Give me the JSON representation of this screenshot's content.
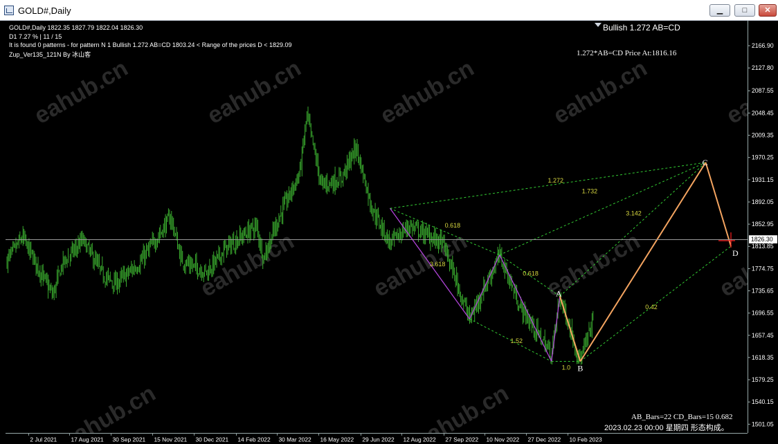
{
  "window": {
    "title": "GOLD#,Daily",
    "buttons": {
      "minimize": "▁",
      "maximize": "□",
      "close": "✕"
    }
  },
  "header": {
    "symbol_line": "GOLD#,Daily  1822.35 1827.79 1822.04 1826.30",
    "timeframe_line": "D1  7.27 %  |  11 / 15",
    "found_line": "It is found 0 patterns  -  for pattern N 1 Bullish 1.272 AB=CD  1803.24 < Range of the prices D < 1829.09",
    "indicator_line": "Zup_Ver135_121N By 冰山客"
  },
  "pattern": {
    "title": "Bullish 1.272 AB=CD",
    "target_label": "1.272*AB=CD Price At:1816.16",
    "bars_info": "AB_Bars=22 CD_Bars=15 0.682",
    "datetime": "2023.02.23 00:00  星期四  形态构成。",
    "points": [
      {
        "label": "A",
        "date": "2022-10-04",
        "price": 1729
      },
      {
        "label": "B",
        "date": "2022-10-21",
        "price": 1617
      },
      {
        "label": "C",
        "date": "2023-02-02",
        "price": 1959
      },
      {
        "label": "D",
        "date": "2023-02-23",
        "price": 1815
      }
    ],
    "ratios": [
      "1.272",
      "1.732",
      "0.618",
      "3.142",
      "3.618",
      "0.618",
      "1.52",
      "1.0",
      "0.42"
    ]
  },
  "watermark": "eahub.cn",
  "colors": {
    "background": "#000000",
    "bullish_candle": "#3aaa2e",
    "cd_leg": "#f4a460",
    "xa_leg": "#b044d8",
    "ratio_lines": "#33cc33",
    "ratio_text": "#d8d840",
    "price_line": "#9a9a9a"
  },
  "chart_data": {
    "type": "candlestick",
    "symbol": "GOLD#",
    "timeframe": "Daily",
    "current_price": "1826.30",
    "ylim": [
      1501.05,
      2190
    ],
    "price_ticks": [
      "2166.90",
      "2127.80",
      "2087.55",
      "2048.45",
      "2009.35",
      "1970.25",
      "1931.15",
      "1892.05",
      "1852.95",
      "1813.85",
      "1774.75",
      "1735.65",
      "1696.55",
      "1657.45",
      "1618.35",
      "1579.25",
      "1540.15",
      "1501.05"
    ],
    "time_ticks": [
      "2 Jul 2021",
      "17 Aug 2021",
      "30 Sep 2021",
      "15 Nov 2021",
      "30 Dec 2021",
      "14 Feb 2022",
      "30 Mar 2022",
      "16 May 2022",
      "29 Jun 2022",
      "12 Aug 2022",
      "27 Sep 2022",
      "10 Nov 2022",
      "27 Dec 2022",
      "10 Feb 2023"
    ],
    "trend_close": [
      [
        "2021-07-02",
        1790
      ],
      [
        "2021-07-15",
        1830
      ],
      [
        "2021-08-09",
        1730
      ],
      [
        "2021-08-17",
        1785
      ],
      [
        "2021-09-03",
        1825
      ],
      [
        "2021-09-20",
        1765
      ],
      [
        "2021-09-30",
        1750
      ],
      [
        "2021-10-20",
        1785
      ],
      [
        "2021-11-15",
        1865
      ],
      [
        "2021-11-24",
        1790
      ],
      [
        "2021-12-15",
        1770
      ],
      [
        "2021-12-30",
        1810
      ],
      [
        "2022-01-25",
        1850
      ],
      [
        "2022-01-31",
        1795
      ],
      [
        "2022-02-14",
        1870
      ],
      [
        "2022-03-02",
        1940
      ],
      [
        "2022-03-08",
        2040
      ],
      [
        "2022-03-20",
        1920
      ],
      [
        "2022-04-05",
        1930
      ],
      [
        "2022-04-18",
        1985
      ],
      [
        "2022-05-01",
        1880
      ],
      [
        "2022-05-16",
        1820
      ],
      [
        "2022-06-01",
        1850
      ],
      [
        "2022-06-29",
        1820
      ],
      [
        "2022-07-21",
        1690
      ],
      [
        "2022-08-15",
        1800
      ],
      [
        "2022-09-01",
        1710
      ],
      [
        "2022-09-27",
        1630
      ],
      [
        "2022-10-04",
        1729
      ],
      [
        "2022-10-21",
        1617
      ],
      [
        "2022-11-10",
        1755
      ],
      [
        "2022-12-01",
        1790
      ],
      [
        "2022-12-27",
        1830
      ],
      [
        "2023-01-20",
        1930
      ],
      [
        "2023-02-02",
        1959
      ],
      [
        "2023-02-23",
        1815
      ]
    ]
  }
}
